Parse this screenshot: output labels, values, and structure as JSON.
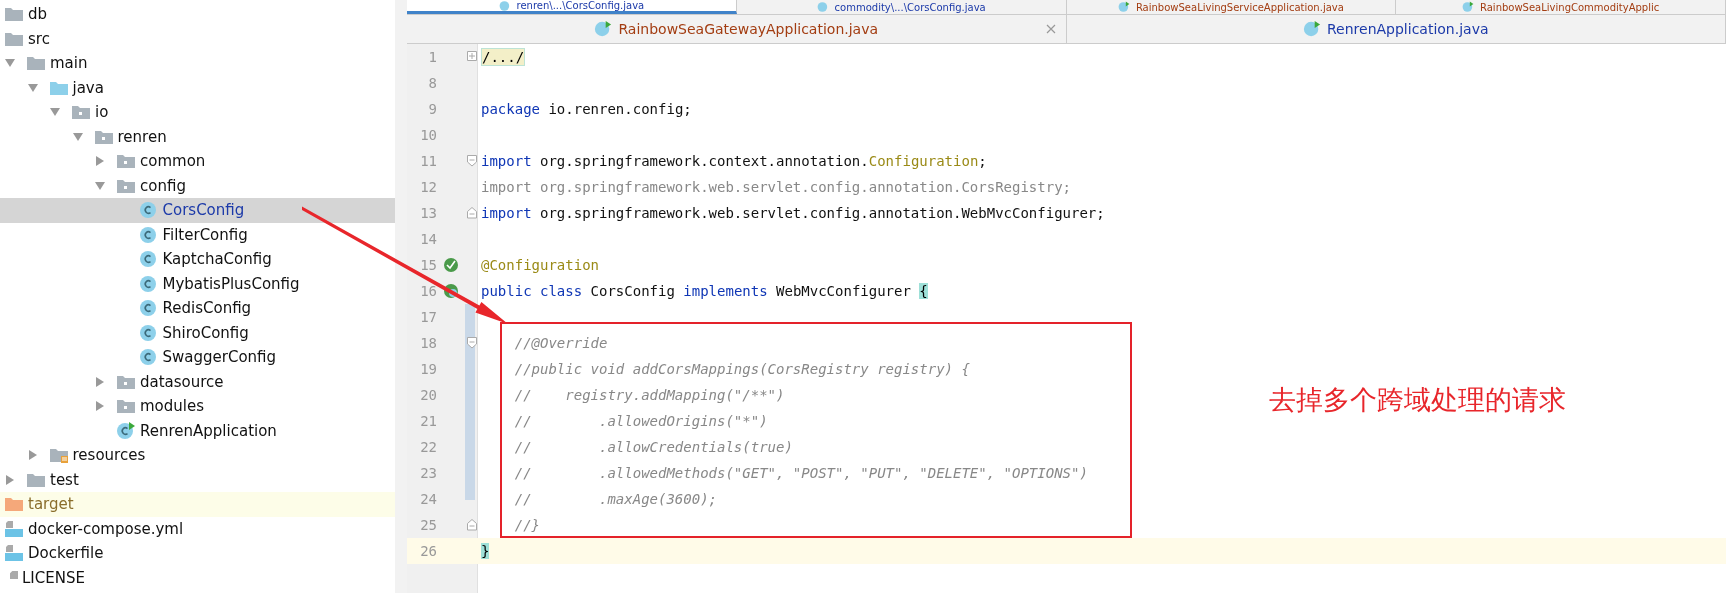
{
  "project_tree": [
    {
      "name": "db",
      "kind": "folder",
      "selected": false
    },
    {
      "name": "src",
      "kind": "folder",
      "selected": false
    },
    {
      "name": "main",
      "kind": "folder",
      "selected": false,
      "expanded": true,
      "children": [
        {
          "name": "java",
          "kind": "source-folder",
          "selected": false,
          "expanded": true,
          "children": [
            {
              "name": "io",
              "kind": "package",
              "selected": false,
              "expanded": true,
              "children": [
                {
                  "name": "renren",
                  "kind": "package",
                  "selected": false,
                  "expanded": true,
                  "children": [
                    {
                      "name": "common",
                      "kind": "package",
                      "selected": false,
                      "expanded": false
                    },
                    {
                      "name": "config",
                      "kind": "package",
                      "selected": false,
                      "expanded": true,
                      "children": [
                        {
                          "name": "CorsConfig",
                          "kind": "class",
                          "selected": true
                        },
                        {
                          "name": "FilterConfig",
                          "kind": "class",
                          "selected": false
                        },
                        {
                          "name": "KaptchaConfig",
                          "kind": "class",
                          "selected": false
                        },
                        {
                          "name": "MybatisPlusConfig",
                          "kind": "class",
                          "selected": false
                        },
                        {
                          "name": "RedisConfig",
                          "kind": "class",
                          "selected": false
                        },
                        {
                          "name": "ShiroConfig",
                          "kind": "class",
                          "selected": false
                        },
                        {
                          "name": "SwaggerConfig",
                          "kind": "class",
                          "selected": false
                        }
                      ]
                    },
                    {
                      "name": "datasource",
                      "kind": "package",
                      "selected": false,
                      "expanded": false
                    },
                    {
                      "name": "modules",
                      "kind": "package",
                      "selected": false,
                      "expanded": false
                    },
                    {
                      "name": "RenrenApplication",
                      "kind": "app",
                      "selected": false
                    }
                  ]
                }
              ]
            }
          ]
        },
        {
          "name": "resources",
          "kind": "resources",
          "selected": false,
          "expanded": false
        }
      ]
    },
    {
      "name": "test",
      "kind": "folder",
      "selected": false,
      "expanded": false
    },
    {
      "name": "target",
      "kind": "excluded",
      "selected": false
    },
    {
      "name": "docker-compose.yml",
      "kind": "docker-compose",
      "selected": false
    },
    {
      "name": "Dockerfile",
      "kind": "dockerfile",
      "selected": false
    },
    {
      "name": "LICENSE",
      "kind": "file",
      "selected": false
    }
  ],
  "tab_rows": [
    [
      {
        "label": "renren\\...\\CorsConfig.java",
        "kind": "class",
        "selected": true
      },
      {
        "label": "commodity\\...\\CorsConfig.java",
        "kind": "class",
        "selected": false
      },
      {
        "label": "RainbowSeaLivingServiceApplication.java",
        "kind": "app",
        "selected": false
      },
      {
        "label": "RainbowSeaLivingCommodityApplic",
        "kind": "app",
        "selected": false
      }
    ],
    [
      {
        "label": "RainbowSeaGatewayApplication.java",
        "kind": "app",
        "selected": false,
        "closable": true
      },
      {
        "label": "RenrenApplication.java",
        "kind": "app",
        "selected": false,
        "closable": false
      }
    ]
  ],
  "code_lines": [
    {
      "number": "1",
      "tokens": [
        {
          "text": "/.../",
          "kind": "folded"
        }
      ],
      "fold": {
        "kind": "plus"
      }
    },
    {
      "number": "8"
    },
    {
      "number": "9",
      "tokens": [
        {
          "text": "package",
          "kind": "keyword"
        },
        {
          "text": " io.renren.config;",
          "kind": "plain"
        }
      ]
    },
    {
      "number": "10"
    },
    {
      "number": "11",
      "tokens": [
        {
          "text": "import",
          "kind": "keyword"
        },
        {
          "text": " org.springframework.context.annotation.",
          "kind": "plain"
        },
        {
          "text": "Configuration",
          "kind": "annotation"
        },
        {
          "text": ";",
          "kind": "plain"
        }
      ],
      "fold": {
        "kind": "open"
      }
    },
    {
      "number": "12",
      "tokens": [
        {
          "text": "import org.springframework.web.servlet.config.annotation.CorsRegistry;",
          "kind": "unused"
        }
      ]
    },
    {
      "number": "13",
      "tokens": [
        {
          "text": "import",
          "kind": "keyword"
        },
        {
          "text": " org.springframework.web.servlet.config.annotation.WebMvcConfigurer;",
          "kind": "plain"
        }
      ],
      "fold": {
        "kind": "close"
      }
    },
    {
      "number": "14"
    },
    {
      "number": "15",
      "tokens": [
        {
          "text": "@Configuration",
          "kind": "annotation"
        }
      ],
      "gutter": {
        "kind": "bean"
      }
    },
    {
      "number": "16",
      "tokens": [
        {
          "text": "public class",
          "kind": "keyword"
        },
        {
          "text": " CorsConfig ",
          "kind": "plain"
        },
        {
          "text": "implements",
          "kind": "keyword"
        },
        {
          "text": " WebMvcConfigurer ",
          "kind": "plain"
        },
        {
          "text": "{",
          "kind": "brace"
        }
      ],
      "gutter": {
        "kind": "implements"
      }
    },
    {
      "number": "17"
    },
    {
      "number": "18",
      "tokens": [
        {
          "text": "    //@Override",
          "kind": "comment"
        }
      ],
      "fold": {
        "kind": "open"
      }
    },
    {
      "number": "19",
      "tokens": [
        {
          "text": "    //public void addCorsMappings(CorsRegistry registry) {",
          "kind": "comment"
        }
      ]
    },
    {
      "number": "20",
      "tokens": [
        {
          "text": "    //    registry.addMapping(\"/**\")",
          "kind": "comment"
        }
      ]
    },
    {
      "number": "21",
      "tokens": [
        {
          "text": "    //        .allowedOrigins(\"*\")",
          "kind": "comment"
        }
      ]
    },
    {
      "number": "22",
      "tokens": [
        {
          "text": "    //        .allowCredentials(true)",
          "kind": "comment"
        }
      ]
    },
    {
      "number": "23",
      "tokens": [
        {
          "text": "    //        .allowedMethods(\"GET\", \"POST\", \"PUT\", \"DELETE\", \"OPTIONS\")",
          "kind": "comment"
        }
      ]
    },
    {
      "number": "24",
      "tokens": [
        {
          "text": "    //        .maxAge(3600);",
          "kind": "comment"
        }
      ]
    },
    {
      "number": "25",
      "tokens": [
        {
          "text": "    //}",
          "kind": "comment"
        }
      ],
      "fold": {
        "kind": "close"
      }
    },
    {
      "number": "26",
      "tokens": [
        {
          "text": "}",
          "kind": "brace"
        }
      ],
      "current": true
    }
  ],
  "annotation": {
    "note": "去掉多个跨域处理的请求"
  }
}
